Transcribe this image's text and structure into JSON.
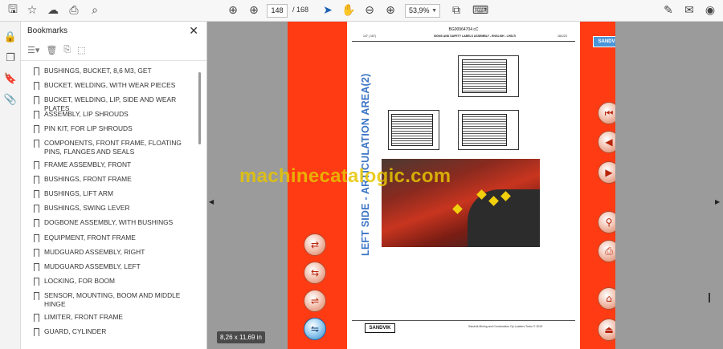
{
  "toolbar": {
    "page_current": "148",
    "page_total": "/ 168",
    "zoom": "53,9%"
  },
  "bookmarks": {
    "title": "Bookmarks",
    "items": [
      "BUSHINGS, BUCKET, 8,6 M3, GET",
      "BUCKET, WELDING, WITH WEAR PIECES",
      "BUCKET, WELDING, LIP, SIDE AND WEAR PLATES",
      "ASSEMBLY, LIP SHROUDS",
      "PIN KIT, FOR LIP SHROUDS",
      "COMPONENTS, FRONT FRAME, FLOATING PINS, FLANGES AND SEALS",
      "FRAME ASSEMBLY, FRONT",
      "BUSHINGS, FRONT FRAME",
      "BUSHINGS, LIFT ARM",
      "BUSHINGS, SWING LEVER",
      "DOGBONE ASSEMBLY, WITH BUSHINGS",
      "EQUIPMENT, FRONT FRAME",
      "MUDGUARD ASSEMBLY, RIGHT",
      "MUDGUARD ASSEMBLY, LEFT",
      "LOCKING, FOR BOOM",
      "SENSOR, MOUNTING, BOOM AND MIDDLE HINGE",
      "LIMITER, FRONT FRAME",
      "GUARD, CYLINDER"
    ]
  },
  "document": {
    "header_code": "BG00964704 cC",
    "header_left": "147 ( 167)",
    "header_title": "SIGNS AND SAFETY LABELS ASSEMBLY - ENGLISH - LH517i",
    "header_right": "181223",
    "vertical_title": "LEFT SIDE - ARTICULATION AREA(2)",
    "logo_top": "SANDVIK",
    "logo_bottom": "SANDVIK",
    "footer": "Sandvik Mining and Construction Oy Loaders Turku © 2019"
  },
  "watermark": "machinecatalogic.com",
  "size_badge": "8,26 x 11,69 in"
}
